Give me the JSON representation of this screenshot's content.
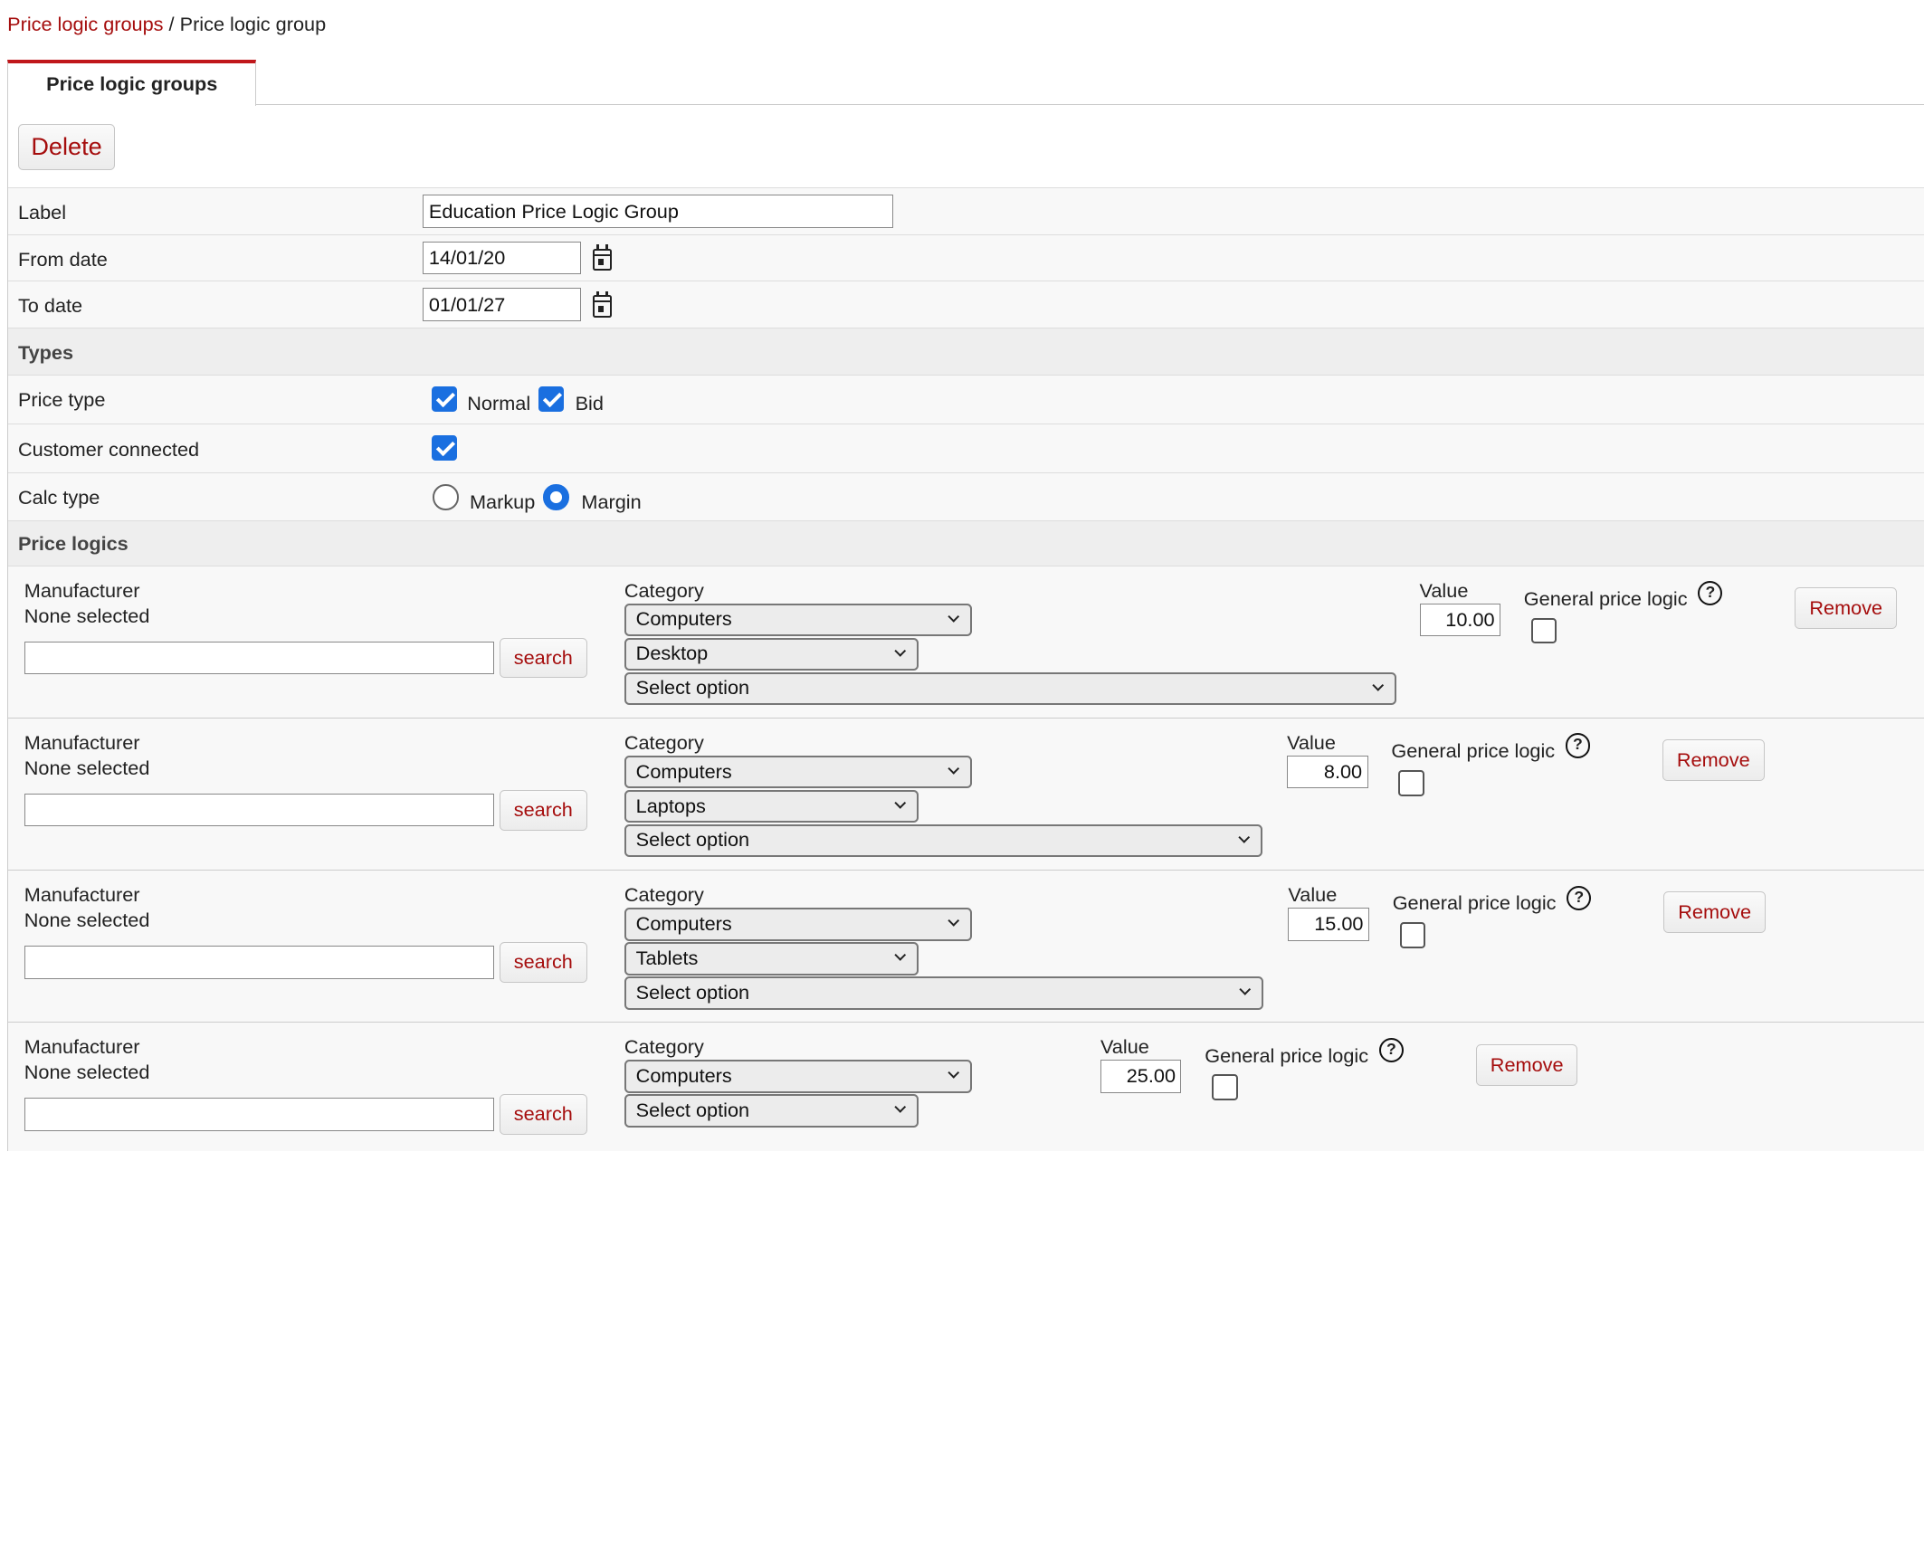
{
  "breadcrumb": {
    "parent": "Price logic groups",
    "separator": "/",
    "current": "Price logic group"
  },
  "tab": {
    "label": "Price logic groups"
  },
  "toolbar": {
    "delete_label": "Delete"
  },
  "form": {
    "label": {
      "caption": "Label",
      "value": "Education Price Logic Group"
    },
    "from_date": {
      "caption": "From date",
      "value": "14/01/20"
    },
    "to_date": {
      "caption": "To date",
      "value": "01/01/27"
    },
    "types_header": "Types",
    "price_type": {
      "caption": "Price type",
      "options": [
        {
          "label": "Normal",
          "checked": true
        },
        {
          "label": "Bid",
          "checked": true
        }
      ]
    },
    "customer_connected": {
      "caption": "Customer connected",
      "checked": true
    },
    "calc_type": {
      "caption": "Calc type",
      "options": [
        {
          "label": "Markup",
          "selected": false
        },
        {
          "label": "Margin",
          "selected": true
        }
      ]
    },
    "price_logics_header": "Price logics"
  },
  "price_logics": [
    {
      "manufacturer_label": "Manufacturer",
      "manufacturer_value": "None selected",
      "search_value": "",
      "search_label": "search",
      "category_label": "Category",
      "category_selects": [
        "Computers",
        "Desktop",
        "Select option"
      ],
      "value_label": "Value",
      "value": "10.00",
      "general_label": "General price logic",
      "help_glyph": "?",
      "general_checked": false,
      "remove_label": "Remove"
    },
    {
      "manufacturer_label": "Manufacturer",
      "manufacturer_value": "None selected",
      "search_value": "",
      "search_label": "search",
      "category_label": "Category",
      "category_selects": [
        "Computers",
        "Laptops",
        "Select option"
      ],
      "value_label": "Value",
      "value": "8.00",
      "general_label": "General price logic",
      "help_glyph": "?",
      "general_checked": false,
      "remove_label": "Remove"
    },
    {
      "manufacturer_label": "Manufacturer",
      "manufacturer_value": "None selected",
      "search_value": "",
      "search_label": "search",
      "category_label": "Category",
      "category_selects": [
        "Computers",
        "Tablets",
        "Select option"
      ],
      "value_label": "Value",
      "value": "15.00",
      "general_label": "General price logic",
      "help_glyph": "?",
      "general_checked": false,
      "remove_label": "Remove"
    },
    {
      "manufacturer_label": "Manufacturer",
      "manufacturer_value": "None selected",
      "search_value": "",
      "search_label": "search",
      "category_label": "Category",
      "category_selects": [
        "Computers",
        "Select option"
      ],
      "value_label": "Value",
      "value": "25.00",
      "general_label": "General price logic",
      "help_glyph": "?",
      "general_checked": false,
      "remove_label": "Remove"
    }
  ]
}
